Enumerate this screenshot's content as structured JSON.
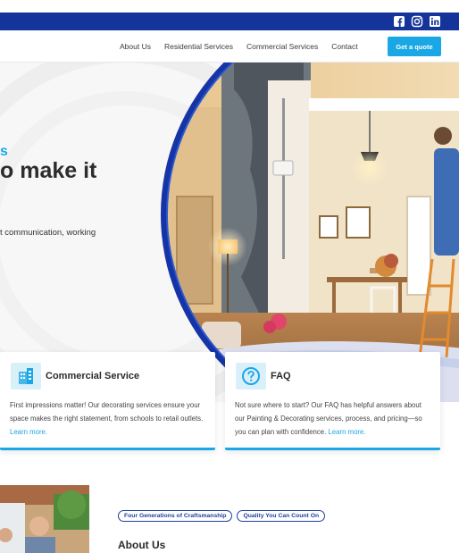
{
  "nav": {
    "items": [
      "About Us",
      "Residential Services",
      "Commercial Services",
      "Contact"
    ],
    "cta": "Get a quote"
  },
  "social": [
    "facebook-icon",
    "instagram-icon",
    "linkedin-icon"
  ],
  "hero": {
    "accent": "s",
    "heading": "o make it",
    "sub": "t communication, working"
  },
  "cards": [
    {
      "title": "Commercial Service",
      "text": "First impressions matter! Our decorating services ensure your space makes the right statement, from schools to retail outlets.",
      "link": "Learn more."
    },
    {
      "title": "FAQ",
      "text": "Not sure where to start? Our FAQ has helpful answers about our Painting & Decorating services, process, and pricing—so you can plan with confidence.",
      "link": "Learn more."
    }
  ],
  "about": {
    "tags": [
      "Four Generations of Craftsmanship",
      "Quality You Can Count On"
    ],
    "title": "About Us"
  },
  "colors": {
    "primary": "#14349a",
    "accent": "#1aa7e5"
  }
}
